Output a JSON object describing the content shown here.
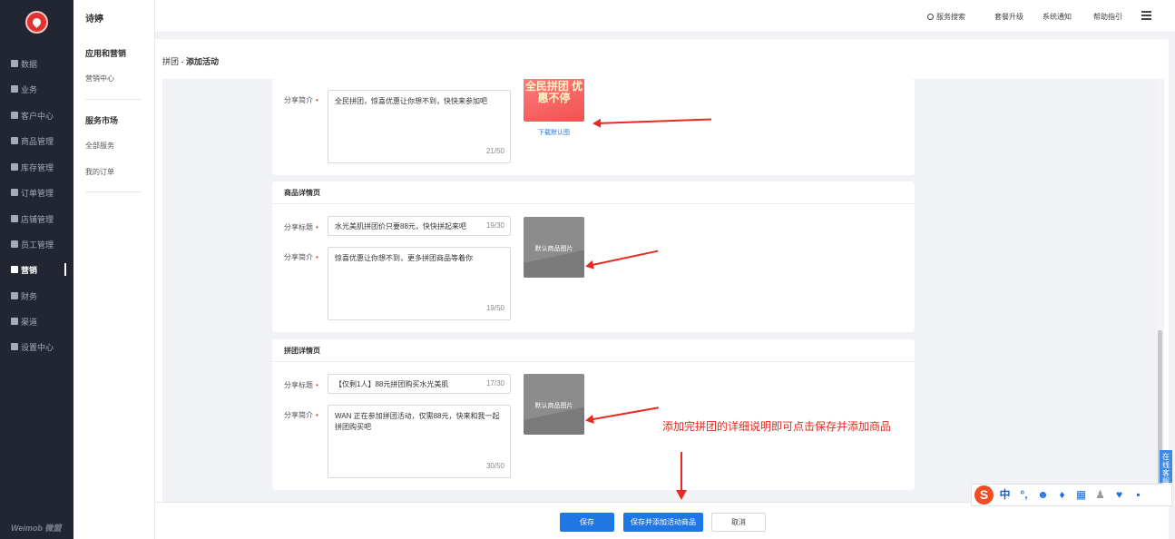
{
  "sidebar": {
    "items": [
      {
        "label": "数据"
      },
      {
        "label": "业务"
      },
      {
        "label": "客户中心"
      },
      {
        "label": "商品管理"
      },
      {
        "label": "库存管理"
      },
      {
        "label": "订单管理"
      },
      {
        "label": "店铺管理"
      },
      {
        "label": "员工管理"
      },
      {
        "label": "营销"
      },
      {
        "label": "财务"
      },
      {
        "label": "渠道"
      },
      {
        "label": "设置中心"
      }
    ],
    "brand": "Weimob 微盟"
  },
  "subnav": {
    "title": "诗婷",
    "group1": "应用和营销",
    "link1": "营销中心",
    "group2": "服务市场",
    "link2": "全部服务",
    "link3": "我的订单"
  },
  "topbar": {
    "search": "服务搜索",
    "upgrade": "套餐升级",
    "notify": "系统通知",
    "help": "帮助指引"
  },
  "breadcrumb": {
    "parent": "拼团",
    "sep": " - ",
    "current": "添加活动"
  },
  "section_top": {
    "share_desc_label": "分享简介",
    "share_desc_value": "全民拼团，惊喜优惠让你想不到，快快来参加吧",
    "share_desc_count": "21/50",
    "promo_text": "全民拼团 优惠不停",
    "download_link": "下载默认图"
  },
  "section_goods": {
    "title": "商品详情页",
    "share_title_label": "分享标题",
    "share_title_value": "水光美肌拼团价只要88元，快快拼起来吧",
    "share_title_count": "19/30",
    "share_desc_label": "分享简介",
    "share_desc_value": "惊喜优惠让你想不到，更多拼团商品等着你",
    "share_desc_count": "19/50",
    "image_text": "默认商品图片"
  },
  "section_group": {
    "title": "拼团详情页",
    "share_title_label": "分享标题",
    "share_title_value": "【仅剩1人】88元拼团购买水光美肌",
    "share_title_count": "17/30",
    "share_desc_label": "分享简介",
    "share_desc_value": "WAN 正在参加拼团活动，仅需88元，快来和我一起拼团购买吧",
    "share_desc_count": "30/50",
    "image_text": "默认商品图片"
  },
  "annotation": {
    "note": "添加完拼团的详细说明即可点击保存并添加商品"
  },
  "actions": {
    "save": "保存",
    "save_add": "保存并添加活动商品",
    "cancel": "取消"
  },
  "ime": {
    "logo": "S",
    "lang": "中"
  },
  "chat": {
    "label": "在线客服"
  },
  "colors": {
    "primary": "#1f77e6",
    "annotation": "#e82a22",
    "sidebar": "#222632"
  }
}
